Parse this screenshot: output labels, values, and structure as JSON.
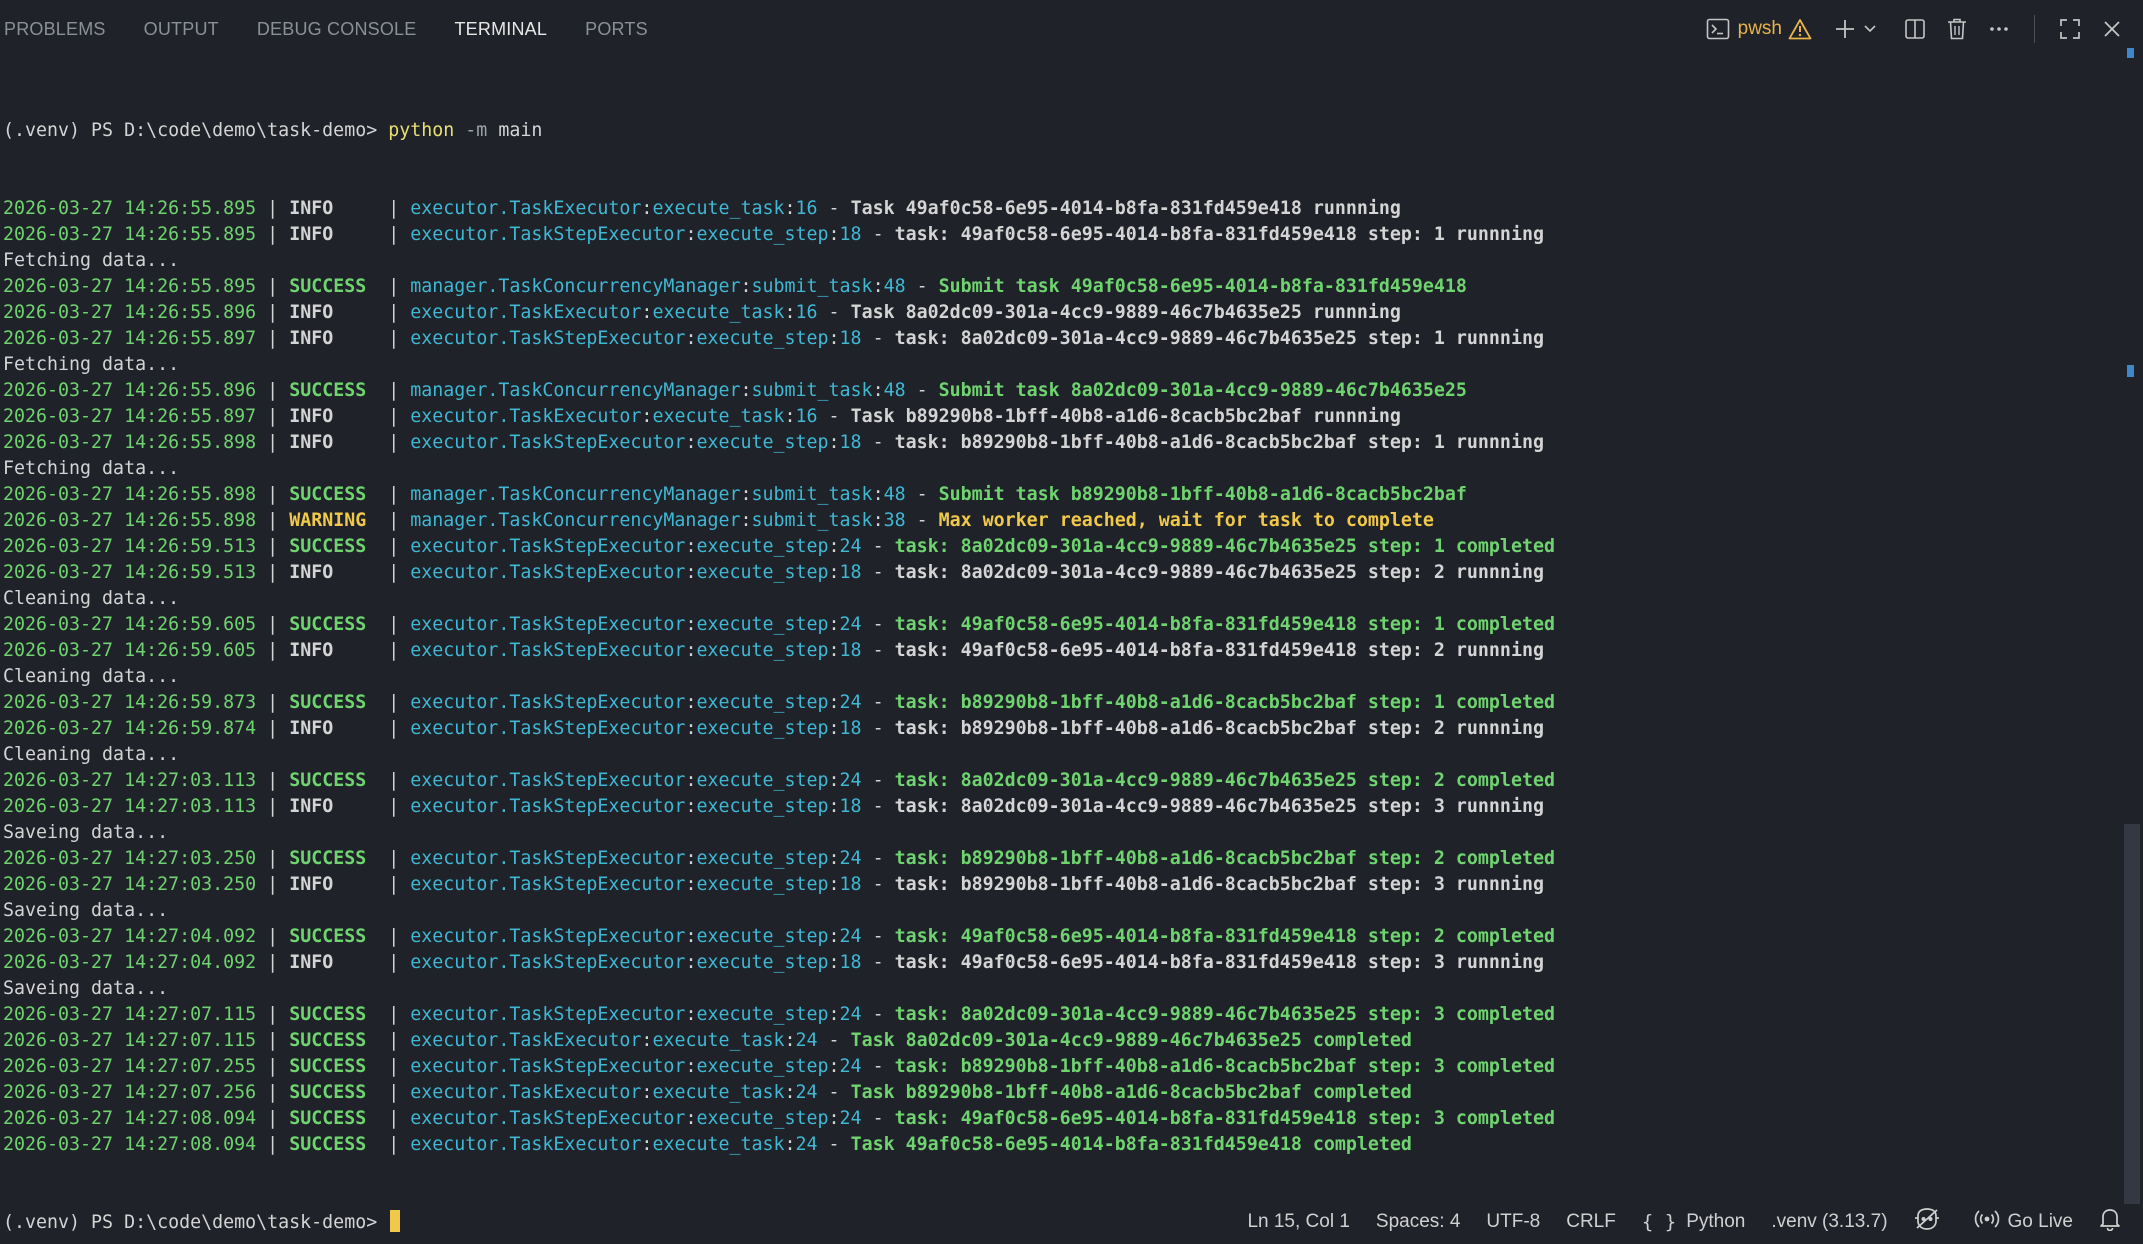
{
  "tabs": [
    {
      "label": "PROBLEMS"
    },
    {
      "label": "OUTPUT"
    },
    {
      "label": "DEBUG CONSOLE"
    },
    {
      "label": "TERMINAL",
      "active": true
    },
    {
      "label": "PORTS"
    }
  ],
  "terminal_selector": {
    "label": "pwsh",
    "icon": "terminal-icon",
    "warning_icon": "warning-icon"
  },
  "actions": [
    {
      "name": "new-terminal-icon"
    },
    {
      "name": "chevron-down-icon"
    },
    {
      "name": "split-terminal-icon"
    },
    {
      "name": "trash-icon"
    },
    {
      "name": "more-actions-icon"
    },
    {
      "name": "maximize-icon"
    },
    {
      "name": "close-icon"
    }
  ],
  "prompt": {
    "text": "(.venv) PS D:\\code\\demo\\task-demo> ",
    "command": "python",
    "flag": "-m",
    "arg": "main"
  },
  "log_lines": [
    {
      "type": "log",
      "ts": "2026-03-27 14:26:55.895",
      "level": "INFO    ",
      "lc": "info",
      "mod": "executor.TaskExecutor",
      "fn": "execute_task",
      "lno": "16",
      "msg": "Task 49af0c58-6e95-4014-b8fa-831fd459e418 runnning"
    },
    {
      "type": "log",
      "ts": "2026-03-27 14:26:55.895",
      "level": "INFO    ",
      "lc": "info",
      "mod": "executor.TaskStepExecutor",
      "fn": "execute_step",
      "lno": "18",
      "msg": "task: 49af0c58-6e95-4014-b8fa-831fd459e418 step: 1 runnning"
    },
    {
      "type": "plain",
      "text": "Fetching data..."
    },
    {
      "type": "log",
      "ts": "2026-03-27 14:26:55.895",
      "level": "SUCCESS ",
      "lc": "success",
      "mod": "manager.TaskConcurrencyManager",
      "fn": "submit_task",
      "lno": "48",
      "msg": "Submit task 49af0c58-6e95-4014-b8fa-831fd459e418"
    },
    {
      "type": "log",
      "ts": "2026-03-27 14:26:55.896",
      "level": "INFO    ",
      "lc": "info",
      "mod": "executor.TaskExecutor",
      "fn": "execute_task",
      "lno": "16",
      "msg": "Task 8a02dc09-301a-4cc9-9889-46c7b4635e25 runnning"
    },
    {
      "type": "log",
      "ts": "2026-03-27 14:26:55.897",
      "level": "INFO    ",
      "lc": "info",
      "mod": "executor.TaskStepExecutor",
      "fn": "execute_step",
      "lno": "18",
      "msg": "task: 8a02dc09-301a-4cc9-9889-46c7b4635e25 step: 1 runnning"
    },
    {
      "type": "plain",
      "text": "Fetching data..."
    },
    {
      "type": "log",
      "ts": "2026-03-27 14:26:55.896",
      "level": "SUCCESS ",
      "lc": "success",
      "mod": "manager.TaskConcurrencyManager",
      "fn": "submit_task",
      "lno": "48",
      "msg": "Submit task 8a02dc09-301a-4cc9-9889-46c7b4635e25"
    },
    {
      "type": "log",
      "ts": "2026-03-27 14:26:55.897",
      "level": "INFO    ",
      "lc": "info",
      "mod": "executor.TaskExecutor",
      "fn": "execute_task",
      "lno": "16",
      "msg": "Task b89290b8-1bff-40b8-a1d6-8cacb5bc2baf runnning"
    },
    {
      "type": "log",
      "ts": "2026-03-27 14:26:55.898",
      "level": "INFO    ",
      "lc": "info",
      "mod": "executor.TaskStepExecutor",
      "fn": "execute_step",
      "lno": "18",
      "msg": "task: b89290b8-1bff-40b8-a1d6-8cacb5bc2baf step: 1 runnning"
    },
    {
      "type": "plain",
      "text": "Fetching data..."
    },
    {
      "type": "log",
      "ts": "2026-03-27 14:26:55.898",
      "level": "SUCCESS ",
      "lc": "success",
      "mod": "manager.TaskConcurrencyManager",
      "fn": "submit_task",
      "lno": "48",
      "msg": "Submit task b89290b8-1bff-40b8-a1d6-8cacb5bc2baf"
    },
    {
      "type": "log",
      "ts": "2026-03-27 14:26:55.898",
      "level": "WARNING ",
      "lc": "warning",
      "mod": "manager.TaskConcurrencyManager",
      "fn": "submit_task",
      "lno": "38",
      "msg": "Max worker reached, wait for task to complete"
    },
    {
      "type": "log",
      "ts": "2026-03-27 14:26:59.513",
      "level": "SUCCESS ",
      "lc": "success",
      "mod": "executor.TaskStepExecutor",
      "fn": "execute_step",
      "lno": "24",
      "msg": "task: 8a02dc09-301a-4cc9-9889-46c7b4635e25 step: 1 completed"
    },
    {
      "type": "log",
      "ts": "2026-03-27 14:26:59.513",
      "level": "INFO    ",
      "lc": "info",
      "mod": "executor.TaskStepExecutor",
      "fn": "execute_step",
      "lno": "18",
      "msg": "task: 8a02dc09-301a-4cc9-9889-46c7b4635e25 step: 2 runnning"
    },
    {
      "type": "plain",
      "text": "Cleaning data..."
    },
    {
      "type": "log",
      "ts": "2026-03-27 14:26:59.605",
      "level": "SUCCESS ",
      "lc": "success",
      "mod": "executor.TaskStepExecutor",
      "fn": "execute_step",
      "lno": "24",
      "msg": "task: 49af0c58-6e95-4014-b8fa-831fd459e418 step: 1 completed"
    },
    {
      "type": "log",
      "ts": "2026-03-27 14:26:59.605",
      "level": "INFO    ",
      "lc": "info",
      "mod": "executor.TaskStepExecutor",
      "fn": "execute_step",
      "lno": "18",
      "msg": "task: 49af0c58-6e95-4014-b8fa-831fd459e418 step: 2 runnning"
    },
    {
      "type": "plain",
      "text": "Cleaning data..."
    },
    {
      "type": "log",
      "ts": "2026-03-27 14:26:59.873",
      "level": "SUCCESS ",
      "lc": "success",
      "mod": "executor.TaskStepExecutor",
      "fn": "execute_step",
      "lno": "24",
      "msg": "task: b89290b8-1bff-40b8-a1d6-8cacb5bc2baf step: 1 completed"
    },
    {
      "type": "log",
      "ts": "2026-03-27 14:26:59.874",
      "level": "INFO    ",
      "lc": "info",
      "mod": "executor.TaskStepExecutor",
      "fn": "execute_step",
      "lno": "18",
      "msg": "task: b89290b8-1bff-40b8-a1d6-8cacb5bc2baf step: 2 runnning"
    },
    {
      "type": "plain",
      "text": "Cleaning data..."
    },
    {
      "type": "log",
      "ts": "2026-03-27 14:27:03.113",
      "level": "SUCCESS ",
      "lc": "success",
      "mod": "executor.TaskStepExecutor",
      "fn": "execute_step",
      "lno": "24",
      "msg": "task: 8a02dc09-301a-4cc9-9889-46c7b4635e25 step: 2 completed"
    },
    {
      "type": "log",
      "ts": "2026-03-27 14:27:03.113",
      "level": "INFO    ",
      "lc": "info",
      "mod": "executor.TaskStepExecutor",
      "fn": "execute_step",
      "lno": "18",
      "msg": "task: 8a02dc09-301a-4cc9-9889-46c7b4635e25 step: 3 runnning"
    },
    {
      "type": "plain",
      "text": "Saveing data..."
    },
    {
      "type": "log",
      "ts": "2026-03-27 14:27:03.250",
      "level": "SUCCESS ",
      "lc": "success",
      "mod": "executor.TaskStepExecutor",
      "fn": "execute_step",
      "lno": "24",
      "msg": "task: b89290b8-1bff-40b8-a1d6-8cacb5bc2baf step: 2 completed"
    },
    {
      "type": "log",
      "ts": "2026-03-27 14:27:03.250",
      "level": "INFO    ",
      "lc": "info",
      "mod": "executor.TaskStepExecutor",
      "fn": "execute_step",
      "lno": "18",
      "msg": "task: b89290b8-1bff-40b8-a1d6-8cacb5bc2baf step: 3 runnning"
    },
    {
      "type": "plain",
      "text": "Saveing data..."
    },
    {
      "type": "log",
      "ts": "2026-03-27 14:27:04.092",
      "level": "SUCCESS ",
      "lc": "success",
      "mod": "executor.TaskStepExecutor",
      "fn": "execute_step",
      "lno": "24",
      "msg": "task: 49af0c58-6e95-4014-b8fa-831fd459e418 step: 2 completed"
    },
    {
      "type": "log",
      "ts": "2026-03-27 14:27:04.092",
      "level": "INFO    ",
      "lc": "info",
      "mod": "executor.TaskStepExecutor",
      "fn": "execute_step",
      "lno": "18",
      "msg": "task: 49af0c58-6e95-4014-b8fa-831fd459e418 step: 3 runnning"
    },
    {
      "type": "plain",
      "text": "Saveing data..."
    },
    {
      "type": "log",
      "ts": "2026-03-27 14:27:07.115",
      "level": "SUCCESS ",
      "lc": "success",
      "mod": "executor.TaskStepExecutor",
      "fn": "execute_step",
      "lno": "24",
      "msg": "task: 8a02dc09-301a-4cc9-9889-46c7b4635e25 step: 3 completed"
    },
    {
      "type": "log",
      "ts": "2026-03-27 14:27:07.115",
      "level": "SUCCESS ",
      "lc": "success",
      "mod": "executor.TaskExecutor",
      "fn": "execute_task",
      "lno": "24",
      "msg": "Task 8a02dc09-301a-4cc9-9889-46c7b4635e25 completed"
    },
    {
      "type": "log",
      "ts": "2026-03-27 14:27:07.255",
      "level": "SUCCESS ",
      "lc": "success",
      "mod": "executor.TaskStepExecutor",
      "fn": "execute_step",
      "lno": "24",
      "msg": "task: b89290b8-1bff-40b8-a1d6-8cacb5bc2baf step: 3 completed"
    },
    {
      "type": "log",
      "ts": "2026-03-27 14:27:07.256",
      "level": "SUCCESS ",
      "lc": "success",
      "mod": "executor.TaskExecutor",
      "fn": "execute_task",
      "lno": "24",
      "msg": "Task b89290b8-1bff-40b8-a1d6-8cacb5bc2baf completed"
    },
    {
      "type": "log",
      "ts": "2026-03-27 14:27:08.094",
      "level": "SUCCESS ",
      "lc": "success",
      "mod": "executor.TaskStepExecutor",
      "fn": "execute_step",
      "lno": "24",
      "msg": "task: 49af0c58-6e95-4014-b8fa-831fd459e418 step: 3 completed"
    },
    {
      "type": "log",
      "ts": "2026-03-27 14:27:08.094",
      "level": "SUCCESS ",
      "lc": "success",
      "mod": "executor.TaskExecutor",
      "fn": "execute_task",
      "lno": "24",
      "msg": "Task 49af0c58-6e95-4014-b8fa-831fd459e418 completed"
    }
  ],
  "final_prompt": "(.venv) PS D:\\code\\demo\\task-demo> ",
  "statusbar": {
    "position": "Ln 15, Col 1",
    "spaces": "Spaces: 4",
    "encoding": "UTF-8",
    "eol": "CRLF",
    "language_braces": "{ }",
    "language": "Python",
    "interpreter": ".venv (3.13.7)",
    "copilot_icon": "copilot-icon",
    "go_live": "Go Live",
    "go_live_icon": "broadcast-icon",
    "bell_icon": "bell-icon"
  },
  "colors": {
    "background": "#1f2229",
    "timestamp": "#6fd36f",
    "success": "#6fd36f",
    "warning": "#f0c84a",
    "module": "#3fb8d4",
    "command": "#e8df72",
    "cursor": "#f2c84b",
    "pwsh": "#e8b34a"
  }
}
